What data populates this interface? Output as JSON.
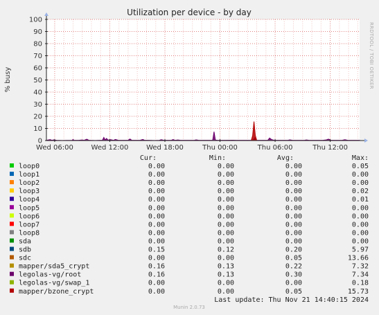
{
  "chart_data": {
    "type": "area",
    "title": "Utilization per device - by day",
    "ylabel": "% busy",
    "ylim": [
      0,
      100
    ],
    "yticks": [
      0,
      10,
      20,
      30,
      40,
      50,
      60,
      70,
      80,
      90,
      100
    ],
    "x_tick_labels": [
      "Wed 06:00",
      "Wed 12:00",
      "Wed 18:00",
      "Thu 00:00",
      "Thu 06:00",
      "Thu 12:00"
    ],
    "x_tick_hours": [
      6,
      12,
      18,
      24,
      30,
      36
    ],
    "xlim_hours": [
      5.1,
      39.2
    ],
    "grid": true,
    "watermark": "RRDTOOL / TOBI OETIKER",
    "legend_headers": {
      "cur": "Cur:",
      "min": "Min:",
      "avg": "Avg:",
      "max": "Max:"
    },
    "series": [
      {
        "name": "loop0",
        "color": "#00cc00",
        "cur": "0.00",
        "min": "0.00",
        "avg": "0.00",
        "max": "0.05"
      },
      {
        "name": "loop1",
        "color": "#0066b3",
        "cur": "0.00",
        "min": "0.00",
        "avg": "0.00",
        "max": "0.00"
      },
      {
        "name": "loop2",
        "color": "#ff8000",
        "cur": "0.00",
        "min": "0.00",
        "avg": "0.00",
        "max": "0.00"
      },
      {
        "name": "loop3",
        "color": "#ffcc00",
        "cur": "0.00",
        "min": "0.00",
        "avg": "0.00",
        "max": "0.02"
      },
      {
        "name": "loop4",
        "color": "#330099",
        "cur": "0.00",
        "min": "0.00",
        "avg": "0.00",
        "max": "0.01"
      },
      {
        "name": "loop5",
        "color": "#990099",
        "cur": "0.00",
        "min": "0.00",
        "avg": "0.00",
        "max": "0.00"
      },
      {
        "name": "loop6",
        "color": "#ccff00",
        "cur": "0.00",
        "min": "0.00",
        "avg": "0.00",
        "max": "0.00"
      },
      {
        "name": "loop7",
        "color": "#ff0000",
        "cur": "0.00",
        "min": "0.00",
        "avg": "0.00",
        "max": "0.00"
      },
      {
        "name": "loop8",
        "color": "#808080",
        "cur": "0.00",
        "min": "0.00",
        "avg": "0.00",
        "max": "0.00"
      },
      {
        "name": "sda",
        "color": "#008f00",
        "cur": "0.00",
        "min": "0.00",
        "avg": "0.00",
        "max": "0.00"
      },
      {
        "name": "sdb",
        "color": "#00487d",
        "cur": "0.15",
        "min": "0.12",
        "avg": "0.20",
        "max": "5.97"
      },
      {
        "name": "sdc",
        "color": "#b35a00",
        "cur": "0.00",
        "min": "0.00",
        "avg": "0.05",
        "max": "13.66"
      },
      {
        "name": "mapper/sda5_crypt",
        "color": "#b38f00",
        "cur": "0.16",
        "min": "0.13",
        "avg": "0.22",
        "max": "7.32"
      },
      {
        "name": "legolas-vg/root",
        "color": "#6b006b",
        "cur": "0.16",
        "min": "0.13",
        "avg": "0.30",
        "max": "7.34"
      },
      {
        "name": "legolas-vg/swap_1",
        "color": "#8fb300",
        "cur": "0.00",
        "min": "0.00",
        "avg": "0.00",
        "max": "0.18"
      },
      {
        "name": "mapper/bzone_crypt",
        "color": "#b30000",
        "cur": "0.00",
        "min": "0.00",
        "avg": "0.05",
        "max": "15.73"
      }
    ],
    "plot_series": [
      {
        "name": "legolas-vg/root",
        "color": "#6b006b",
        "x_hours": [
          5.1,
          5.5,
          5.7,
          5.9,
          6.2,
          6.8,
          7.9,
          8.0,
          8.1,
          8.6,
          9.0,
          9.2,
          9.5,
          9.7,
          9.9,
          10.4,
          11.2,
          11.35,
          11.5,
          11.65,
          11.8,
          12.1,
          12.4,
          12.6,
          12.9,
          13.2,
          13.6,
          14.0,
          14.2,
          14.4,
          14.8,
          15.3,
          15.6,
          15.8,
          16.2,
          16.9,
          17.4,
          17.6,
          17.9,
          18.3,
          18.7,
          18.9,
          19.1,
          19.4,
          19.7,
          20.4,
          21.2,
          21.4,
          21.7,
          23.2,
          23.35,
          23.5,
          23.7,
          24.4,
          25.4,
          25.8,
          26.6,
          27.6,
          27.8,
          28.0,
          28.2,
          28.6,
          29.2,
          29.4,
          29.6,
          29.9,
          30.6,
          31.4,
          31.6,
          31.9,
          32.4,
          33.2,
          33.4,
          33.7,
          34.4,
          35.2,
          35.6,
          35.8,
          36.1,
          36.6,
          37.3,
          37.6,
          37.9,
          38.4,
          39.2
        ],
        "y": [
          0.2,
          0.8,
          0.2,
          0.6,
          0.2,
          0.1,
          0.2,
          0.9,
          0.2,
          0.2,
          0.5,
          0.2,
          1.1,
          0.3,
          0.2,
          0.1,
          0.3,
          2.6,
          0.5,
          1.8,
          0.4,
          0.7,
          0.2,
          0.9,
          0.3,
          0.2,
          0.2,
          0.3,
          1.3,
          0.2,
          0.2,
          0.2,
          0.9,
          0.2,
          0.2,
          0.1,
          0.2,
          0.7,
          0.2,
          0.2,
          0.2,
          0.8,
          0.2,
          0.5,
          0.2,
          0.2,
          0.2,
          0.6,
          0.2,
          0.2,
          7.3,
          0.4,
          0.2,
          0.2,
          0.3,
          0.2,
          0.2,
          0.2,
          2.4,
          0.3,
          0.2,
          0.2,
          0.2,
          2.1,
          0.9,
          0.2,
          0.2,
          0.2,
          0.6,
          0.2,
          0.2,
          0.2,
          0.5,
          0.2,
          0.2,
          0.2,
          0.6,
          1.2,
          0.2,
          0.2,
          0.2,
          0.7,
          0.2,
          0.2,
          0.2
        ]
      },
      {
        "name": "mapper/bzone_crypt",
        "color": "#b30000",
        "x_hours": [
          5.1,
          27.4,
          27.55,
          27.7,
          27.85,
          28.0,
          39.2
        ],
        "y": [
          0,
          0,
          4.0,
          15.7,
          4.0,
          0,
          0
        ]
      }
    ],
    "footer": "Last update: Thu Nov 21 14:40:15 2024",
    "version": "Munin 2.0.73"
  }
}
